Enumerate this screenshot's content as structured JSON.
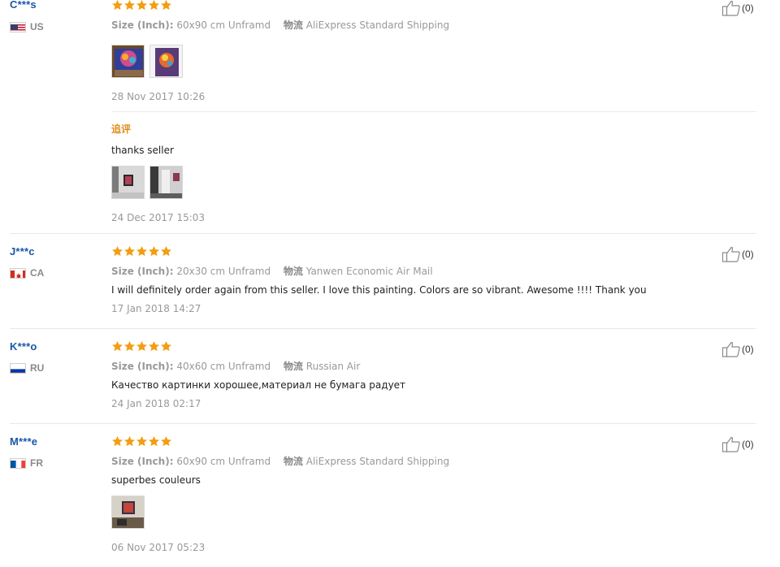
{
  "colors": {
    "star": "#f29e12",
    "user": "#1a57a6",
    "addon": "#e38c1a"
  },
  "reviews": [
    {
      "user": "C***s",
      "country": "US",
      "size_label": "Size (Inch):",
      "size_value": "60x90 cm Unframd",
      "ship_label": "物流",
      "ship_value": "AliExpress Standard Shipping",
      "date": "28 Nov 2017 10:26",
      "helpful": "(0)",
      "stars": 5,
      "addon": {
        "title": "追评",
        "text": "thanks seller",
        "date": "24 Dec 2017 15:03"
      }
    },
    {
      "user": "J***c",
      "country": "CA",
      "size_label": "Size (Inch):",
      "size_value": "20x30 cm Unframd",
      "ship_label": "物流",
      "ship_value": "Yanwen Economic Air Mail",
      "text": "I will definitely order again from this seller. I love this painting. Colors are so vibrant. Awesome !!!! Thank you",
      "date": "17 Jan 2018 14:27",
      "helpful": "(0)",
      "stars": 5
    },
    {
      "user": "K***o",
      "country": "RU",
      "size_label": "Size (Inch):",
      "size_value": "40x60 cm Unframd",
      "ship_label": "物流",
      "ship_value": "Russian Air",
      "text": "Качество картинки хорошее,материал не бумага радует",
      "date": "24 Jan 2018 02:17",
      "helpful": "(0)",
      "stars": 5
    },
    {
      "user": "M***e",
      "country": "FR",
      "size_label": "Size (Inch):",
      "size_value": "60x90 cm Unframd",
      "ship_label": "物流",
      "ship_value": "AliExpress Standard Shipping",
      "text": "superbes couleurs",
      "date": "06 Nov 2017 05:23",
      "helpful": "(0)",
      "stars": 5
    }
  ]
}
